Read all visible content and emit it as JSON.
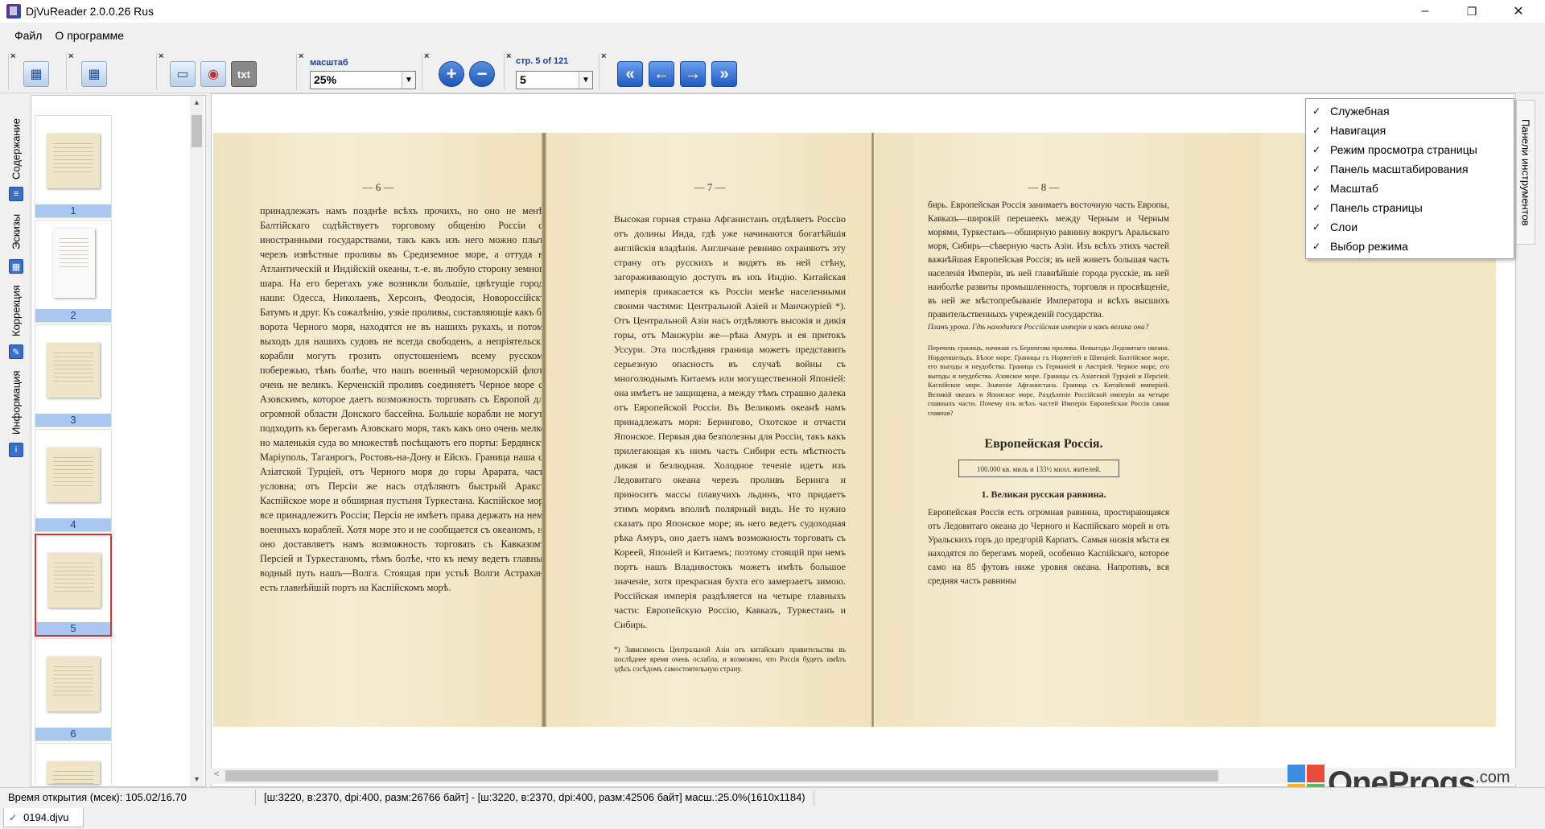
{
  "window": {
    "title": "DjVuReader 2.0.0.26 Rus",
    "minimize_glyph": "–",
    "maximize_glyph": "❐",
    "close_glyph": "✕"
  },
  "menu": {
    "items": [
      {
        "label": "Файл"
      },
      {
        "label": "О программе"
      }
    ]
  },
  "toolbar": {
    "scale_label": "масштаб",
    "scale_value": "25%",
    "page_label": "стр. 5 of 121",
    "page_value": "5",
    "close_glyph": "×",
    "txt_label": "txt",
    "zoom_in_glyph": "+",
    "zoom_out_glyph": "−",
    "nav_first_glyph": "«",
    "nav_prev_glyph": "←",
    "nav_next_glyph": "→",
    "nav_last_glyph": "»"
  },
  "sidetabs": [
    {
      "label": "Содержание"
    },
    {
      "label": "Эскизы"
    },
    {
      "label": "Коррекция"
    },
    {
      "label": "Информация"
    }
  ],
  "thumbnails": [
    {
      "num": "1"
    },
    {
      "num": "2"
    },
    {
      "num": "3"
    },
    {
      "num": "4"
    },
    {
      "num": "5",
      "selected": true
    },
    {
      "num": "6"
    }
  ],
  "thumb_panel": {
    "close_glyph": "×",
    "scroll_up": "▲",
    "scroll_down": "▼"
  },
  "document": {
    "page6": {
      "num": "— 6 —",
      "text": "принадлежать намъ позднѣе всѣхъ прочихъ, но оно не менѣе Балтійскаго содѣйствуетъ торговому общенію Россіи съ иностранными государствами, такъ какъ изъ него можно плыть черезъ извѣстные проливы въ Средиземное море, а оттуда въ Атлантическій и Индійскій океаны, т.-е. въ любую сторону земного шара. На его берегахъ уже возникли большіе, цвѣтущіе города наши: Одесса, Николаевъ, Херсонъ, Феодосія, Новороссійскъ, Батумъ и друг. Къ сожалѣнію, узкіе проливы, составляющіе какъ бы ворота Черного моря, находятся не въ нашихъ рукахъ, и потому выходъ для нашихъ судовъ не всегда свободенъ, а непріятельскіе корабли могутъ грозить опустошеніемъ всему русскому побережью, тѣмъ болѣе, что нашъ военный черноморскій флотъ очень не великъ. Керченскій проливъ соединяетъ Черное море съ Азовскимъ, которое даетъ возможность торговать съ Европой для огромной области Донского бассейна. Большіе корабли не могутъ подходить къ берегамъ Азовскаго моря, такъ какъ оно очень мелко, но маленькія суда во множествѣ посѣщаютъ его порты: Бердянскъ, Маріуполь, Таганрогъ, Ростовъ-на-Дону и Ейскъ. Граница наша съ Азіатской Турціей, отъ Черного моря до горы Арарата, часто условна; отъ Персіи же насъ отдѣляютъ быстрый Араксъ, Каспійское море и обширная пустыня Туркестана. Каспійское море все принадлежитъ Россіи; Персія не имѣетъ права держать на немъ военныхъ кораблей. Хотя море это и не сообщается съ океаномъ, но оно доставляетъ намъ возможность торговать съ Кавказомъ, Персіей и Туркестаномъ, тѣмъ болѣе, что къ нему ведетъ главный водный путь нашъ—Волга. Стоящая при устьѣ Волги Астрахань есть главнѣйшій портъ на Каспійскомъ морѣ."
    },
    "page7": {
      "num": "— 7 —",
      "text": "Высокая горная страна Афганистанъ отдѣляетъ Россію отъ долины Инда, гдѣ уже начинаются богатѣйшія англійскія владѣнія. Англичане ревниво охраняютъ эту страну отъ русскихъ и видятъ въ ней стѣну, загораживающую доступъ въ ихъ Индію. Китайская имперія прикасается къ Россіи менѣе населенными своими частями: Центральной Азіей и Манчжуріей *). Отъ Центральной Азіи насъ отдѣляютъ высокія и дикія горы, отъ Манжуріи же—рѣка Амуръ и ея притокъ Уссури. Эта послѣдняя граница можетъ представить серьезную опасность въ случаѣ войны съ многолюднымъ Китаемъ или могущественной Японіей: она имѣетъ не защищена, а между тѣмъ страшно далека отъ Европейской Россіи. Въ Великомъ океанѣ намъ принадлежатъ моря: Берингово, Охотское и отчасти Японское. Первыя два безполезны для Россіи, такъ какъ прилегающая къ нимъ часть Сибири есть мѣстность дикая и безлюдная. Холодное теченіе идетъ изъ Ледовитаго океана черезъ проливъ Беринга и приноситъ массы плавучихъ льдинъ, что придаетъ этимъ морямъ вполнѣ полярный видъ. Не то нужно сказать про Японское море; въ него ведетъ судоходная рѣка Амуръ, оно даетъ намъ возможность торговать съ Кореей, Японіей и Китаемъ; поэтому стоящій при немъ портъ нашъ Владивостокъ можетъ имѣть большое значеніе, хотя прекрасная бухта его замерзаетъ зимою. Россійская имперія раздѣляется на четыре главныхъ части: Европейскую Россію, Кавказъ, Туркестанъ и Сибирь.",
      "footnote": "*) Зависимость Центральной Азіи отъ китайскаго правительства въ послѣднее время очень ослабла, и возможно, что Россія будетъ имѣть здѣсь сосѣдомъ самостоятельную страну."
    },
    "page8": {
      "num": "— 8 —",
      "text": "бирь. Европейская Россія занимаетъ восточную часть Европы, Кавказъ—широкій перешеекъ между Черным и Черным морями, Туркестанъ—обширную равнину вокругъ Аральскаго моря, Сибирь—сѣверную часть Азіи. Изъ всѣхъ этихъ частей важнѣйшая Европейская Россія; въ ней живетъ большая часть населенія Имперіи, въ ней главнѣйшіе города русскіе, въ ней наиболѣе развиты промышленность, торговля и просвѣщеніе, въ ней же мѣстопребываніе Императора и всѣхъ высшихъ правительственныхъ учрежденій государства.",
      "lesson": "Планъ урока. Гдѣ находится Россійская имперія и какъ велика она?",
      "lesson_body": "Перечень границъ, начиная съ Берингова пролива. Невыгоды Ледовитаго океана. Норденшельдъ. Бѣлое море. Границы съ Норвегіей и Швеціей. Балтійское море, его выгоды и неудобства. Граница съ Германіей и Австріей. Черное море, его выгоды и неудобства. Азовское море. Границы съ Азіатской Турціей и Персіей. Каспійское море. Значеніе Афганистана. Граница съ Китайской имперіей. Великій океанъ и Японское море. Раздѣленіе Россійской имперіи на четыре главныхъ части. Почему изъ всѣхъ частей Имперіи Европейская Россія самая главная?",
      "heading": "Европейская Россія.",
      "boxed": "100.000 кв. миль и 133½ милл. жителей.",
      "subheading": "1. Великая русская равнина.",
      "text2": "Европейская Россія есть огромная равнина, простирающаяся отъ Ледовитаго океана до Черного и Каспійскаго морей и отъ Уральскихъ горъ до предгорій Карпатъ. Самыя низкія мѣста ея находятся по берегамъ морей, особенно Каспійскаго, которое само на 85 футовъ ниже уровня океана. Напротивъ, вся средняя часть равнины"
    }
  },
  "panels_menu": {
    "items": [
      {
        "label": "Служебная",
        "checked": true
      },
      {
        "label": "Навигация",
        "checked": true
      },
      {
        "label": "Режим просмотра страницы",
        "checked": true
      },
      {
        "label": "Панель масштабирования",
        "checked": true
      },
      {
        "label": "Масштаб",
        "checked": true
      },
      {
        "label": "Панель страницы",
        "checked": true
      },
      {
        "label": "Слои",
        "checked": true
      },
      {
        "label": "Выбор режима",
        "checked": true
      }
    ],
    "check_glyph": "✓",
    "side_tab_label": "Панели инструментов"
  },
  "hscroll": {
    "left_glyph": "<"
  },
  "status": {
    "open_time": "Время открытия (мсек): 105.02/16.70",
    "info": "[ш:3220, в:2370, dpi:400, разм:26766 байт] - [ш:3220, в:2370, dpi:400, разм:42506 байт] масш.:25.0%(1610x1184)"
  },
  "file_tab": {
    "name": "0194.djvu",
    "check_glyph": "✓"
  },
  "watermark": {
    "name": "OneProgs",
    "suffix": ".com"
  },
  "colors": {
    "accent": "#1d4f9b",
    "thumb_label_bg": "#a9c7ef",
    "selected_border": "#e03030",
    "paper": "#f1e6c5"
  }
}
